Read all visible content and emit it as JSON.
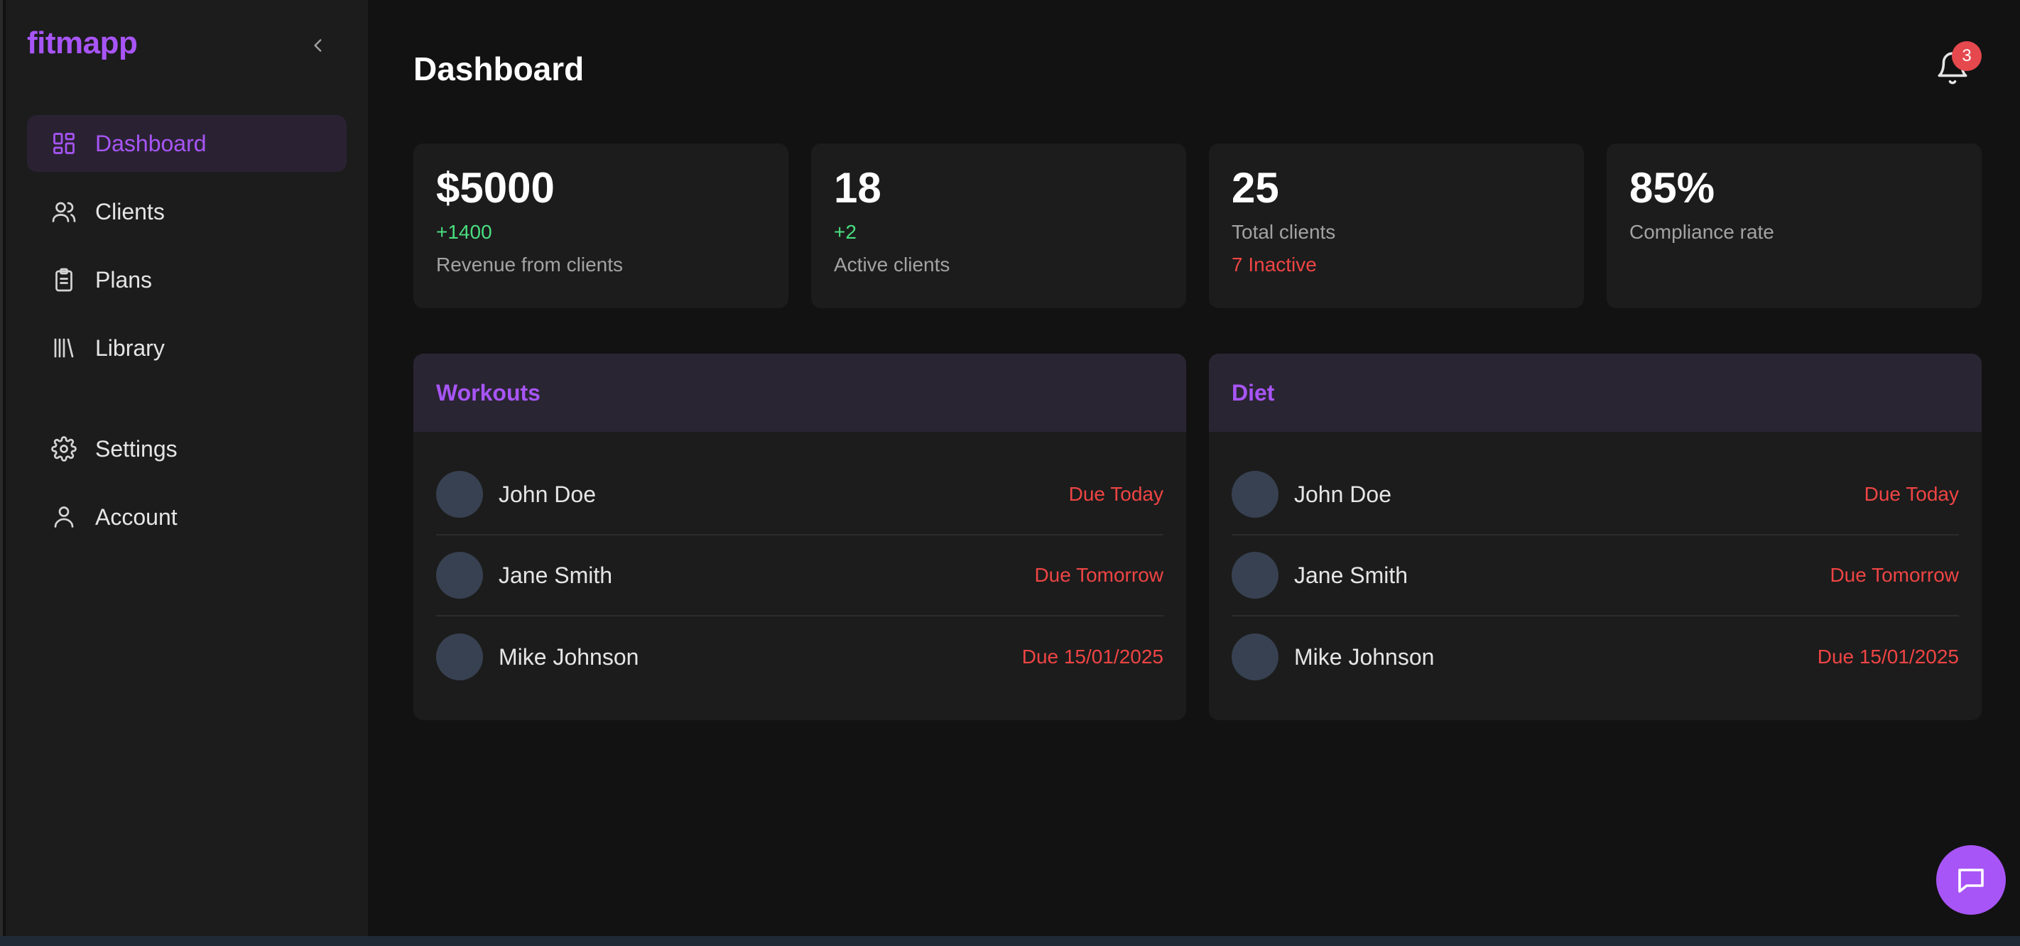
{
  "app": {
    "logo": "fitmapp"
  },
  "sidebar": {
    "items": [
      {
        "label": "Dashboard",
        "icon": "dashboard-icon",
        "active": true
      },
      {
        "label": "Clients",
        "icon": "users-icon"
      },
      {
        "label": "Plans",
        "icon": "clipboard-icon"
      },
      {
        "label": "Library",
        "icon": "library-icon"
      }
    ],
    "secondary": [
      {
        "label": "Settings",
        "icon": "gear-icon"
      },
      {
        "label": "Account",
        "icon": "user-icon"
      }
    ]
  },
  "header": {
    "title": "Dashboard",
    "notifications": "3"
  },
  "stats": [
    {
      "value": "$5000",
      "delta": "+1400",
      "label": "Revenue from clients"
    },
    {
      "value": "18",
      "delta": "+2",
      "label": "Active clients"
    },
    {
      "value": "25",
      "label": "Total clients",
      "extra": "7 Inactive"
    },
    {
      "value": "85%",
      "label": "Compliance rate"
    }
  ],
  "panels": [
    {
      "title": "Workouts",
      "rows": [
        {
          "name": "John Doe",
          "due": "Due Today"
        },
        {
          "name": "Jane Smith",
          "due": "Due Tomorrow"
        },
        {
          "name": "Mike Johnson",
          "due": "Due 15/01/2025"
        }
      ]
    },
    {
      "title": "Diet",
      "rows": [
        {
          "name": "John Doe",
          "due": "Due Today"
        },
        {
          "name": "Jane Smith",
          "due": "Due Tomorrow"
        },
        {
          "name": "Mike Johnson",
          "due": "Due 15/01/2025"
        }
      ]
    }
  ],
  "colors": {
    "accent": "#a855f7",
    "positive": "#4ade80",
    "danger": "#ef4444"
  }
}
